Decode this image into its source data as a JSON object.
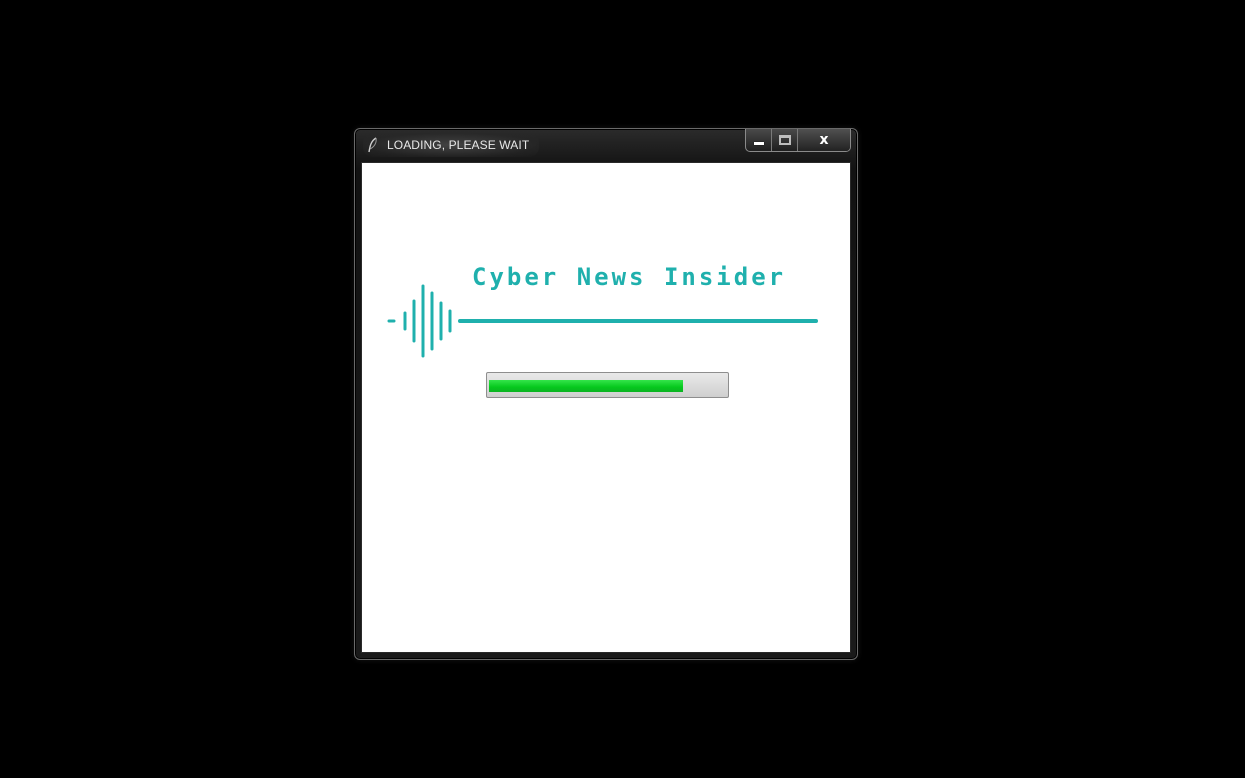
{
  "window": {
    "title": "LOADING, PLEASE WAIT",
    "app_icon": "feather-icon",
    "caption_buttons": {
      "minimize_icon": "minimize-icon",
      "maximize_icon": "maximize-icon",
      "close_icon": "close-icon",
      "close_glyph": "x"
    }
  },
  "splash": {
    "logo_text": "Cyber News Insider",
    "logo_icon": "sound-wave-icon",
    "brand_color": "#1fb0ad"
  },
  "progress": {
    "value": 0.82,
    "fill_color": "#0fd42a",
    "track_color": "#d4d4d4"
  }
}
